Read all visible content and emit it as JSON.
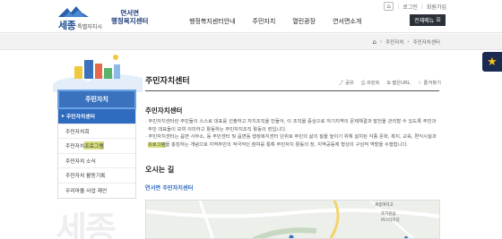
{
  "utility": {
    "home_label": "⌂",
    "login": "로그인",
    "signup": "회원가입"
  },
  "logo": {
    "city": "세종",
    "city_sub": "특별자치시",
    "center_line1": "연서면",
    "center_line2": "행정복지센터"
  },
  "gnb": [
    "행정복지센터안내",
    "주민자치",
    "열린광장",
    "연서면소개"
  ],
  "menu_all": "전체메뉴",
  "breadcrumb": [
    "주민자치",
    "주민자치센터"
  ],
  "lnb": {
    "title": "주민자치",
    "items": [
      {
        "label": "주민자치센터",
        "active": true
      },
      {
        "label": "주민자치회"
      },
      {
        "label_pre": "주민자치",
        "label_hl": "프로그램"
      },
      {
        "label": "주민자치 소식"
      },
      {
        "label": "주민자치 활동기록"
      },
      {
        "label": "우리마을 사업 제안"
      }
    ]
  },
  "watermark": "세종",
  "page_title": "주민자치센터",
  "tools": {
    "share": "공유",
    "print": "프린트",
    "url": "짧은URL",
    "favorite": "즐겨찾기"
  },
  "section_title": "주민자치센터",
  "desc": {
    "p1": "· 주민자치센터란 주민들이 스스로 대표를 선출하고 자치조직을 만들어, 이 조직을 중심으로 자기지역의 문제해결과 발전을 관리할 수 있도록 주민과 주민 대표들이 모여 의미하고 활동하는 주민자치조직 활동의 장입니다.",
    "p2_pre": "· 주민자치센터는 읍면 사무소, 동 주민센터 및 읍면동 행정복지센터 단위로 주민의 삶의 질을 높이기 위해 설치된 각종 문화, 복지, 교육, 편익시설과 ",
    "p2_hl": "프로그램",
    "p2_post": "을 총칭하는 개념으로 지역주민의 적극적인 참여를 통해 주민자치 활동의 장, 지역공동체 형성의 구심적 역할을 수행합니다."
  },
  "directions_title": "오시는 길",
  "directions_sub": "연서면 주민자치센터",
  "map_labels": [
    "세종여자고",
    "조치원읍",
    "버스터미널"
  ],
  "colors": {
    "primary": "#2f6bbf",
    "lnb_title": "#3a72bd",
    "dark_button": "#2c3038",
    "highlight": "#d6dc7a",
    "quick_bg": "#1a2a50",
    "quick_star": "#f6c21b"
  }
}
